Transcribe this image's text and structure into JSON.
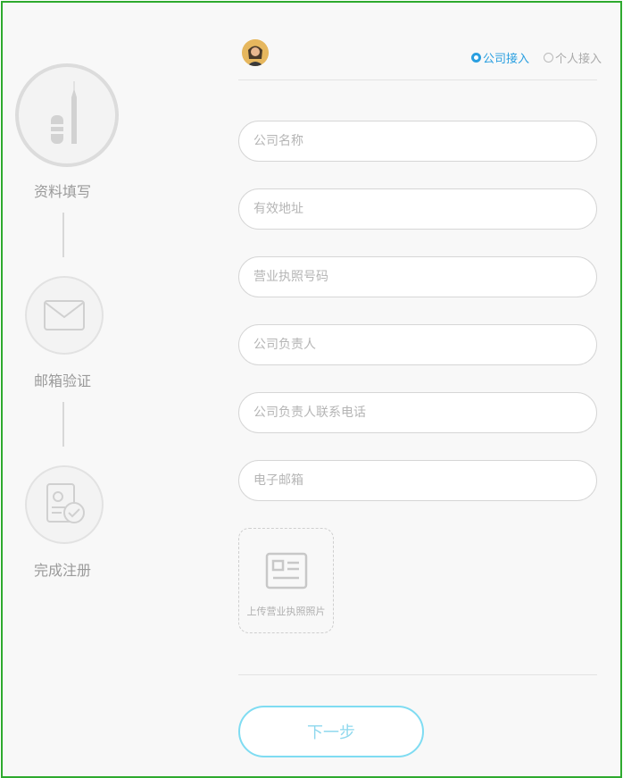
{
  "steps": [
    {
      "label": "资料填写",
      "icon": "pen-icon",
      "state": "active"
    },
    {
      "label": "邮箱验证",
      "icon": "envelope-icon",
      "state": "inactive"
    },
    {
      "label": "完成注册",
      "icon": "id-check-icon",
      "state": "inactive"
    }
  ],
  "header": {
    "avatar": "user-avatar",
    "radio_options": [
      {
        "label": "公司接入",
        "selected": true
      },
      {
        "label": "个人接入",
        "selected": false
      }
    ]
  },
  "form": {
    "fields": [
      {
        "placeholder": "公司名称",
        "value": ""
      },
      {
        "placeholder": "有效地址",
        "value": ""
      },
      {
        "placeholder": "营业执照号码",
        "value": ""
      },
      {
        "placeholder": "公司负责人",
        "value": ""
      },
      {
        "placeholder": "公司负责人联系电话",
        "value": ""
      },
      {
        "placeholder": "电子邮箱",
        "value": ""
      }
    ],
    "upload_label": "上传营业执照照片",
    "next_label": "下一步"
  },
  "colors": {
    "border_frame": "#2eaa2e",
    "accent": "#2a9fe0",
    "button_border": "#7fdcf2"
  }
}
